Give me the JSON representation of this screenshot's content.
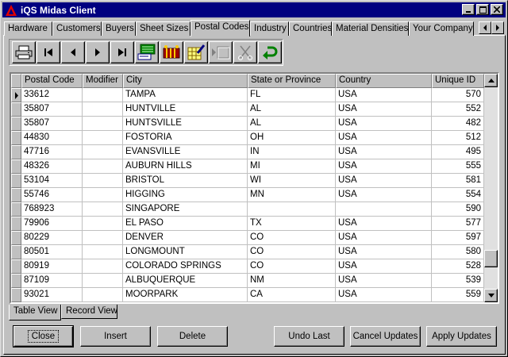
{
  "window": {
    "title": "iQS Midas Client",
    "controls": {
      "minimize": "_",
      "maximize": "□",
      "close": "×"
    }
  },
  "tabs": [
    {
      "label": "Hardware"
    },
    {
      "label": "Customers"
    },
    {
      "label": "Buyers"
    },
    {
      "label": "Sheet Sizes"
    },
    {
      "label": "Postal Codes",
      "active": true
    },
    {
      "label": "Industry"
    },
    {
      "label": "Countries"
    },
    {
      "label": "Material Densities"
    },
    {
      "label": "Your Company"
    }
  ],
  "toolbar": {
    "icons": [
      "printer-icon",
      "first-record-icon",
      "prev-record-icon",
      "next-record-icon",
      "last-record-icon",
      "import-icon",
      "export-icon",
      "edit-icon",
      "insert-disabled-icon",
      "cut-disabled-icon",
      "undo-icon"
    ]
  },
  "grid": {
    "columns": [
      "Postal Code",
      "Modifier",
      "City",
      "State or Province",
      "Country",
      "Unique ID"
    ],
    "rows": [
      [
        "33612",
        "",
        "TAMPA",
        "FL",
        "USA",
        "570"
      ],
      [
        "35807",
        "",
        "HUNTVILLE",
        "AL",
        "USA",
        "552"
      ],
      [
        "35807",
        "",
        "HUNTSVILLE",
        "AL",
        "USA",
        "482"
      ],
      [
        "44830",
        "",
        "FOSTORIA",
        "OH",
        "USA",
        "512"
      ],
      [
        "47716",
        "",
        "EVANSVILLE",
        "IN",
        "USA",
        "495"
      ],
      [
        "48326",
        "",
        "AUBURN HILLS",
        "MI",
        "USA",
        "555"
      ],
      [
        "53104",
        "",
        "BRISTOL",
        "WI",
        "USA",
        "581"
      ],
      [
        "55746",
        "",
        "HIGGING",
        "MN",
        "USA",
        "554"
      ],
      [
        "768923",
        "",
        "SINGAPORE",
        "",
        "",
        "590"
      ],
      [
        "79906",
        "",
        "EL PASO",
        "TX",
        "USA",
        "577"
      ],
      [
        "80229",
        "",
        "DENVER",
        "CO",
        "USA",
        "597"
      ],
      [
        "80501",
        "",
        "LONGMOUNT",
        "CO",
        "USA",
        "580"
      ],
      [
        "80919",
        "",
        "COLORADO SPRINGS",
        "CO",
        "USA",
        "528"
      ],
      [
        "87109",
        "",
        "ALBUQUERQUE",
        "NM",
        "USA",
        "539"
      ],
      [
        "93021",
        "",
        "MOORPARK",
        "CA",
        "USA",
        "559"
      ]
    ],
    "current_row": 0
  },
  "view_tabs": [
    {
      "label": "Table View",
      "active": true
    },
    {
      "label": "Record View"
    }
  ],
  "buttons": {
    "close": "Close",
    "insert": "Insert",
    "delete": "Delete",
    "undo_last": "Undo Last",
    "cancel_updates": "Cancel Updates",
    "apply_updates": "Apply Updates"
  },
  "colors": {
    "title_bar": "#000080",
    "face": "#c0c0c0",
    "grid_bg": "#ffffff"
  }
}
